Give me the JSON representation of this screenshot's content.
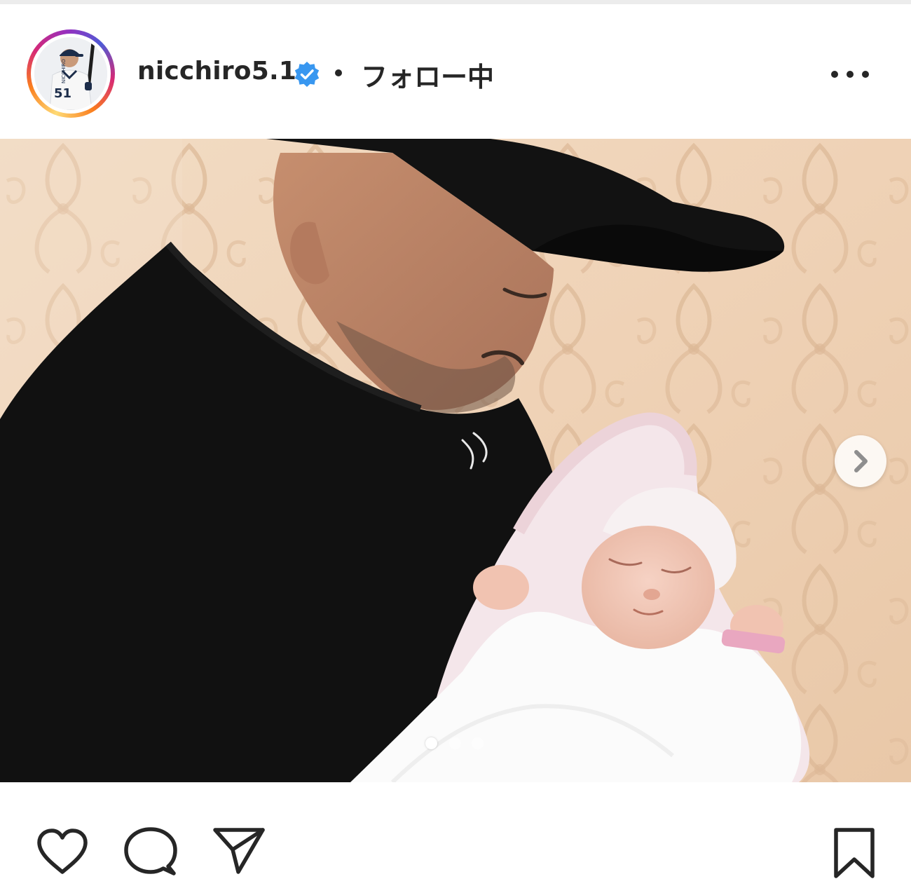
{
  "post": {
    "username": "nicchiro5.1",
    "separator": "•",
    "follow_status": "フォロー中",
    "verified": true,
    "accent_verified": "#3897f0",
    "avatar": {
      "jersey_number": "51",
      "jersey_name": "NICCHIRO"
    },
    "carousel": {
      "slide_count": 3,
      "active_index": 0
    },
    "actions": {
      "like_icon": "heart-icon",
      "comment_icon": "comment-icon",
      "share_icon": "paper-plane-icon",
      "save_icon": "bookmark-icon",
      "more_icon": "more-horizontal-icon",
      "next_icon": "chevron-right-icon"
    }
  }
}
